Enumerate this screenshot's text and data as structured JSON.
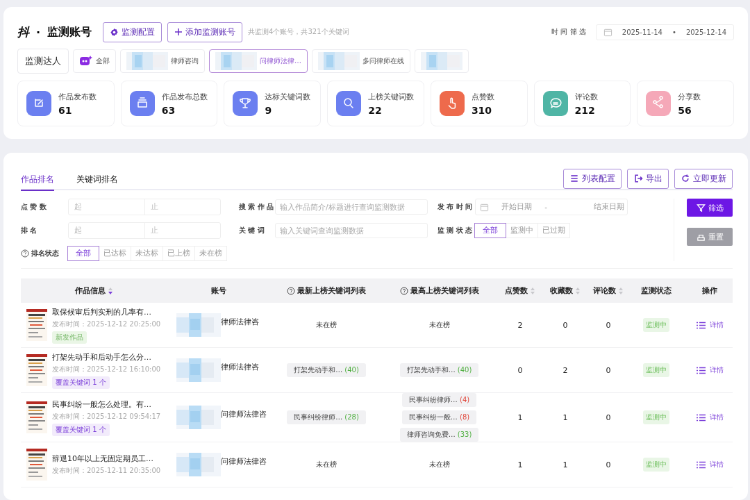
{
  "header": {
    "logo": "抖",
    "dot": "·",
    "title": "监测账号",
    "buttons": [
      {
        "kind": "gear",
        "label": "监测配置"
      },
      {
        "kind": "plus",
        "label": "添加监测账号"
      }
    ],
    "summary": "共监测4个账号，共321个关键词",
    "time_filter": {
      "label": "时 间 筛 选",
      "start": "2025-11-14",
      "separator": "•",
      "end": "2025-12-14"
    }
  },
  "accounts": {
    "label": "监测达人",
    "items": [
      {
        "kind": "all",
        "name": "全部",
        "selected": false
      },
      {
        "kind": "account",
        "name": "律师咨询",
        "selected": false
      },
      {
        "kind": "account",
        "name": "问律师法律…",
        "selected": true
      },
      {
        "kind": "account",
        "name": "多问律师在线",
        "selected": false
      },
      {
        "kind": "account",
        "selected": false
      }
    ]
  },
  "stats": [
    {
      "kind": "edit",
      "label": "作品发布数",
      "value": "61",
      "color": "#6b7ff0"
    },
    {
      "kind": "box",
      "label": "作品发布总数",
      "value": "63",
      "color": "#6b7ff0"
    },
    {
      "kind": "trophy",
      "label": "达标关键词数",
      "value": "9",
      "color": "#6b7ff0"
    },
    {
      "kind": "search",
      "label": "上榜关键词数",
      "value": "22",
      "color": "#6b7ff0"
    },
    {
      "kind": "hand",
      "label": "点赞数",
      "value": "310",
      "color": "#ee6a4c"
    },
    {
      "kind": "chat",
      "label": "评论数",
      "value": "212",
      "color": "#4fb5a5"
    },
    {
      "kind": "share",
      "label": "分享数",
      "value": "56",
      "color": "#f5a8b8"
    }
  ],
  "tabs": [
    {
      "label": "作品排名",
      "selected": true
    },
    {
      "label": "关键词排名",
      "selected": false
    }
  ],
  "actions": [
    {
      "kind": "config",
      "label": "列表配置"
    },
    {
      "kind": "export",
      "label": "导出"
    },
    {
      "kind": "refresh",
      "label": "立即更新"
    }
  ],
  "filters": {
    "likes": {
      "label": "点 赞 数",
      "from": "起",
      "to": "止"
    },
    "rank": {
      "label": "排 名",
      "from": "起",
      "to": "止"
    },
    "search": {
      "label": "搜 索 作 品",
      "placeholder": "输入作品简介/标题进行查询监测数据"
    },
    "keyword": {
      "label": "关 键 词",
      "placeholder": "输入关键词查询监测数据"
    },
    "publish_time": {
      "label": "发 布 时 间",
      "start": "开始日期",
      "separator": "-",
      "end": "结束日期"
    },
    "rank_status": {
      "label": "排名状态",
      "options": [
        {
          "label": "全部",
          "selected": true
        },
        {
          "label": "已达标",
          "selected": false
        },
        {
          "label": "未达标",
          "selected": false
        },
        {
          "label": "已上榜",
          "selected": false
        },
        {
          "label": "未在榜",
          "selected": false
        }
      ]
    },
    "monitor_status": {
      "label": "监 测 状 态",
      "options": [
        {
          "label": "全部",
          "selected": true
        },
        {
          "label": "监测中",
          "selected": false
        },
        {
          "label": "已过期",
          "selected": false
        }
      ]
    },
    "filter_button": "筛选",
    "reset_button": "重置"
  },
  "table": {
    "columns": [
      {
        "label": "作品信息",
        "sortable": true,
        "sorted": true,
        "help": false
      },
      {
        "label": "账号",
        "sortable": false,
        "help": false
      },
      {
        "label": "最新上榜关键词列表",
        "sortable": false,
        "help": true
      },
      {
        "label": "最高上榜关键词列表",
        "sortable": false,
        "help": true
      },
      {
        "label": "点赞数",
        "sortable": true,
        "sorted": false,
        "help": false
      },
      {
        "label": "收藏数",
        "sortable": true,
        "sorted": false,
        "help": false
      },
      {
        "label": "评论数",
        "sortable": true,
        "sorted": false,
        "help": false
      },
      {
        "label": "监测状态",
        "sortable": false,
        "help": false
      },
      {
        "label": "操作",
        "sortable": false,
        "help": false
      }
    ],
    "rows": [
      {
        "title": "取保候审后判实刑的几率有…",
        "published": "发布时间：2025-12-12 20:25:00",
        "tag": {
          "kind": "new",
          "text": "新发作品"
        },
        "account": "律师法律咨",
        "latest": {
          "kind": "text",
          "text": "未在榜"
        },
        "highest": {
          "kind": "text",
          "text": "未在榜"
        },
        "likes": "2",
        "favorites": "0",
        "comments": "0",
        "status": "监测中",
        "action": "详情"
      },
      {
        "title": "打架先动手和后动手怎么分…",
        "published": "发布时间：2025-12-12 16:10:00",
        "tag": {
          "kind": "keywords",
          "text": "覆盖关键词 1 个"
        },
        "account": "律师法律咨",
        "latest": {
          "kind": "chips",
          "chips": [
            {
              "text": "打架先动手和…",
              "count": "(40)",
              "color": "#52b043"
            }
          ]
        },
        "highest": {
          "kind": "chips",
          "chips": [
            {
              "text": "打架先动手和…",
              "count": "(40)",
              "color": "#52b043"
            }
          ]
        },
        "likes": "0",
        "favorites": "2",
        "comments": "0",
        "status": "监测中",
        "action": "详情"
      },
      {
        "title": "民事纠纷一般怎么处理。有…",
        "published": "发布时间：2025-12-12 09:54:17",
        "tag": {
          "kind": "keywords",
          "text": "覆盖关键词 1 个"
        },
        "account": "问律师法律咨",
        "latest": {
          "kind": "chips",
          "chips": [
            {
              "text": "民事纠纷律师…",
              "count": "(28)",
              "color": "#52b043"
            }
          ]
        },
        "highest": {
          "kind": "chips",
          "chips": [
            {
              "text": "民事纠纷律师…",
              "count": "(4)",
              "color": "#e0483c"
            },
            {
              "text": "民事纠纷一般…",
              "count": "(8)",
              "color": "#e0483c"
            },
            {
              "text": "律师咨询免费…",
              "count": "(33)",
              "color": "#52b043"
            }
          ]
        },
        "likes": "1",
        "favorites": "1",
        "comments": "0",
        "status": "监测中",
        "action": "详情"
      },
      {
        "title": "辞退10年以上无固定期员工…",
        "published": "发布时间：2025-12-11 20:35:00",
        "account": "问律师法律咨",
        "latest": {
          "kind": "text",
          "text": "未在榜"
        },
        "highest": {
          "kind": "text",
          "text": "未在榜"
        },
        "likes": "1",
        "favorites": "1",
        "comments": "0",
        "status": "监测中",
        "action": "详情"
      }
    ]
  }
}
